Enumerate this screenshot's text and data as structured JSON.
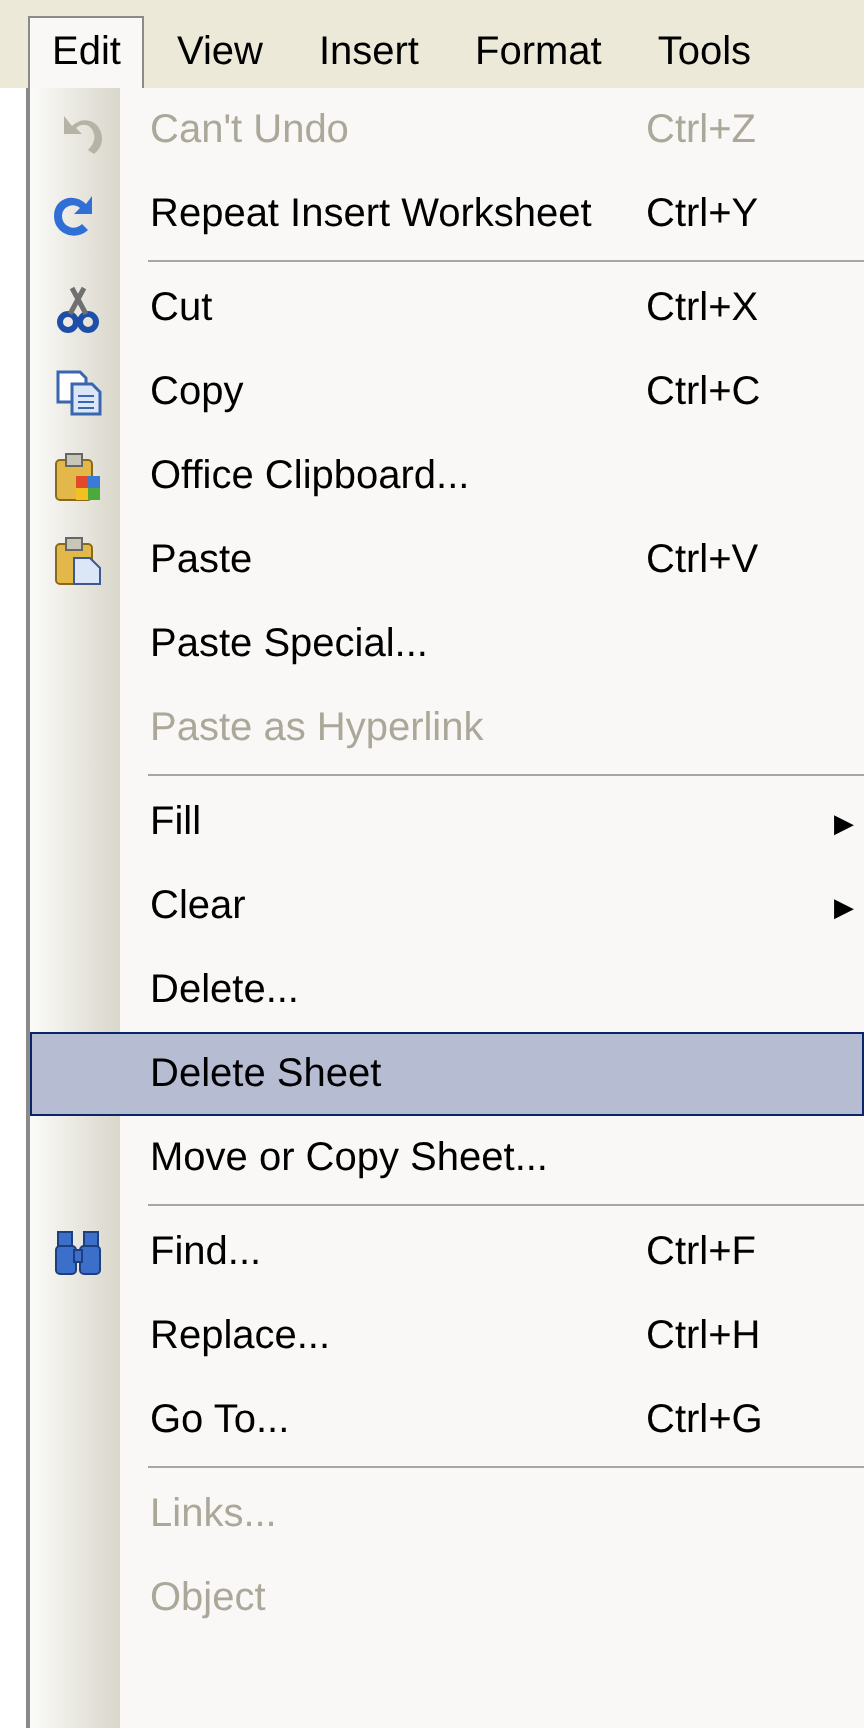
{
  "menu_bar": [
    {
      "label": "Edit",
      "selected": true
    },
    {
      "label": "View",
      "selected": false
    },
    {
      "label": "Insert",
      "selected": false
    },
    {
      "label": "Format",
      "selected": false
    },
    {
      "label": "Tools",
      "selected": false
    }
  ],
  "menu_items": [
    {
      "kind": "command",
      "label": "Can't Undo",
      "shortcut": "Ctrl+Z",
      "disabled": true,
      "selected": false
    },
    {
      "kind": "command",
      "label": "Repeat Insert Worksheet",
      "shortcut": "Ctrl+Y",
      "disabled": false,
      "selected": false
    },
    {
      "kind": "separator"
    },
    {
      "kind": "command",
      "label": "Cut",
      "shortcut": "Ctrl+X",
      "disabled": false,
      "selected": false
    },
    {
      "kind": "command",
      "label": "Copy",
      "shortcut": "Ctrl+C",
      "disabled": false,
      "selected": false
    },
    {
      "kind": "command",
      "label": "Office Clipboard...",
      "disabled": false,
      "selected": false
    },
    {
      "kind": "command",
      "label": "Paste",
      "shortcut": "Ctrl+V",
      "disabled": false,
      "selected": false
    },
    {
      "kind": "command",
      "label": "Paste Special...",
      "disabled": false,
      "selected": false
    },
    {
      "kind": "command",
      "label": "Paste as Hyperlink",
      "disabled": true,
      "selected": false
    },
    {
      "kind": "separator"
    },
    {
      "kind": "submenu",
      "label": "Fill",
      "arrow": "▶",
      "disabled": false,
      "selected": false
    },
    {
      "kind": "submenu",
      "label": "Clear",
      "arrow": "▶",
      "disabled": false,
      "selected": false
    },
    {
      "kind": "command",
      "label": "Delete...",
      "disabled": false,
      "selected": false
    },
    {
      "kind": "command",
      "label": "Delete Sheet",
      "disabled": false,
      "selected": true
    },
    {
      "kind": "command",
      "label": "Move or Copy Sheet...",
      "disabled": false,
      "selected": false
    },
    {
      "kind": "separator"
    },
    {
      "kind": "command",
      "label": "Find...",
      "shortcut": "Ctrl+F",
      "disabled": false,
      "selected": false
    },
    {
      "kind": "command",
      "label": "Replace...",
      "shortcut": "Ctrl+H",
      "disabled": false,
      "selected": false
    },
    {
      "kind": "command",
      "label": "Go To...",
      "shortcut": "Ctrl+G",
      "disabled": false,
      "selected": false
    },
    {
      "kind": "separator"
    },
    {
      "kind": "command",
      "label": "Links...",
      "disabled": true,
      "selected": false
    },
    {
      "kind": "command",
      "label": "Object",
      "disabled": true,
      "selected": false
    }
  ]
}
